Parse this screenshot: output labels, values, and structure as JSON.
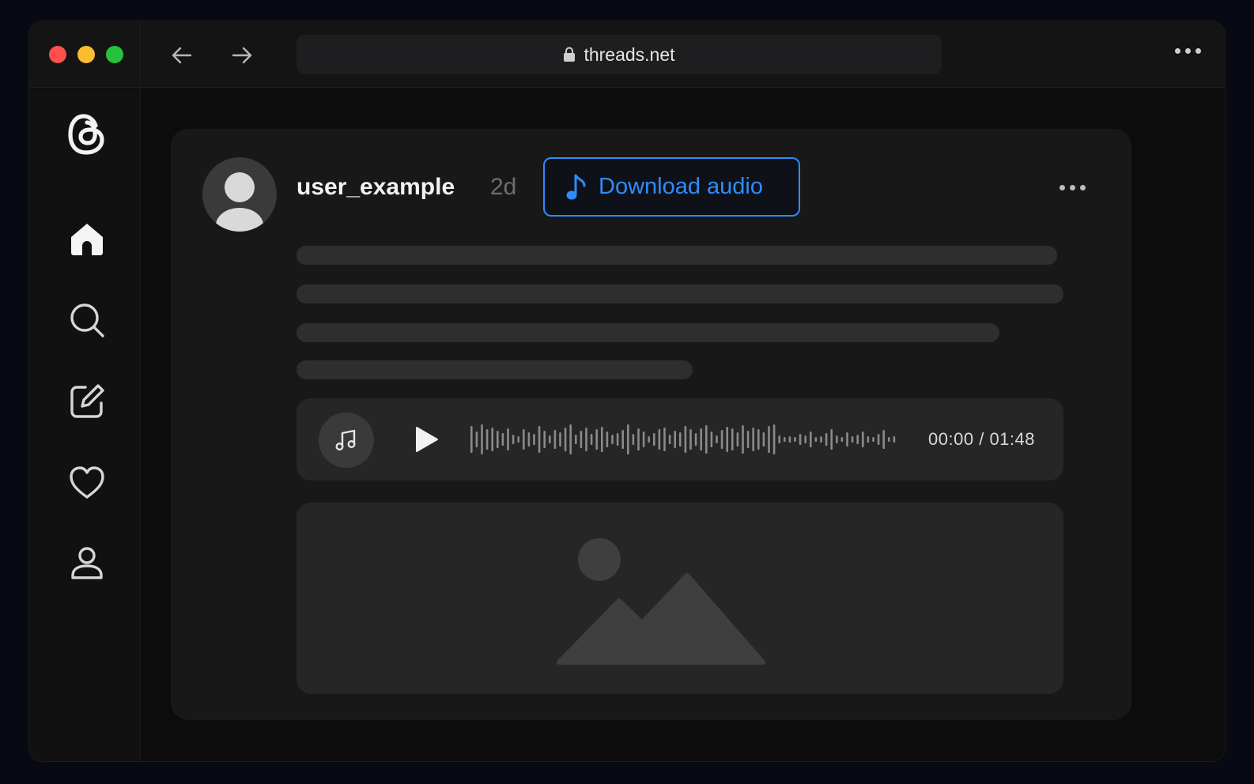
{
  "browser": {
    "url": "threads.net",
    "colors": {
      "close": "#ff4f4b",
      "minimize": "#f9bd2e",
      "maximize": "#24c33b"
    }
  },
  "sidebar": {
    "items": [
      {
        "icon": "threads-logo-icon"
      },
      {
        "icon": "home-icon",
        "active": true
      },
      {
        "icon": "search-icon"
      },
      {
        "icon": "compose-icon"
      },
      {
        "icon": "heart-icon"
      },
      {
        "icon": "profile-icon"
      }
    ]
  },
  "post": {
    "username": "user_example",
    "timestamp": "2d",
    "download_label": "Download audio",
    "accent": "#2f8cff",
    "audio": {
      "time": "00:00 / 01:48",
      "progress": 0
    }
  }
}
